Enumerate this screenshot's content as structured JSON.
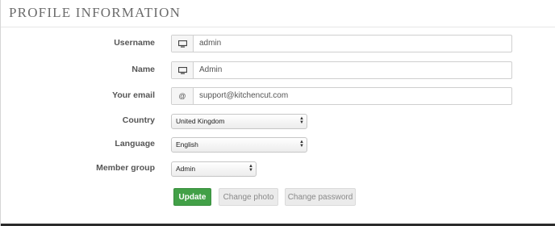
{
  "panel": {
    "title": "PROFILE INFORMATION"
  },
  "form": {
    "username": {
      "label": "Username",
      "value": "admin",
      "icon": "monitor-icon"
    },
    "name": {
      "label": "Name",
      "value": "Admin",
      "icon": "monitor-icon"
    },
    "email": {
      "label": "Your email",
      "value": "support@kitchencut.com",
      "addon": "@"
    },
    "country": {
      "label": "Country",
      "selected": "United Kingdom"
    },
    "language": {
      "label": "Language",
      "selected": "English"
    },
    "member_group": {
      "label": "Member group",
      "selected": "Admin"
    }
  },
  "buttons": {
    "update": "Update",
    "change_photo": "Change photo",
    "change_password": "Change password"
  },
  "colors": {
    "primary": "#42a047",
    "title": "#6b6b6b"
  }
}
